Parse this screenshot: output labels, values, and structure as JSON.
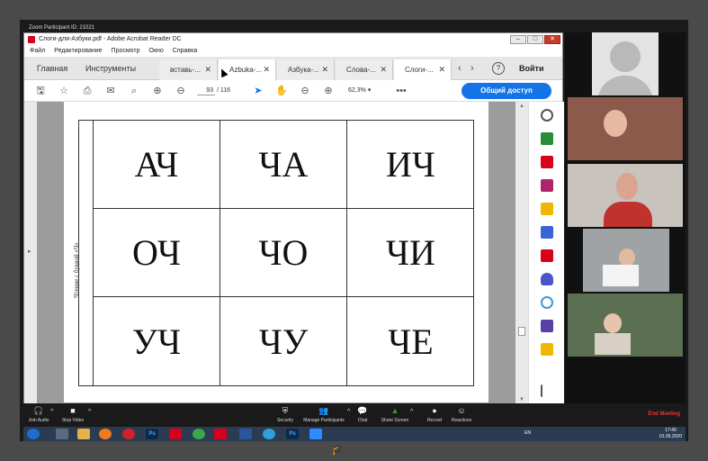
{
  "zoom_window": {
    "title": "Zoom Participant ID: 21021"
  },
  "acrobat": {
    "title": "Слоги-для-Азбуки.pdf - Adobe Acrobat Reader DC",
    "window_buttons": {
      "minimize": "–",
      "maximize": "□",
      "close": "✕"
    },
    "menu": [
      "Файл",
      "Редактирование",
      "Просмотр",
      "Окно",
      "Справка"
    ],
    "nav": {
      "home": "Главная",
      "tools": "Инструменты"
    },
    "tabs": [
      {
        "label": "вставь-...",
        "active": false
      },
      {
        "label": "Azbuka-...",
        "active": true
      },
      {
        "label": "Азбука-...",
        "active": false
      },
      {
        "label": "Слова-...",
        "active": false
      },
      {
        "label": "Слоги-...",
        "active": true
      }
    ],
    "tab_close": "✕",
    "tab_scroll": {
      "left": "‹",
      "right": "›"
    },
    "help": "?",
    "sign_in": "Войти",
    "toolbar": {
      "page_current": "93",
      "page_separator": "/",
      "page_total": "116",
      "zoom": "62,3%",
      "zoom_caret": "▾",
      "more": "•••",
      "share": "Общий доступ"
    },
    "document": {
      "side_caption": "Чтение с буквой «Ч»",
      "syllables": [
        [
          "АЧ",
          "ЧА",
          "ИЧ"
        ],
        [
          "ОЧ",
          "ЧО",
          "ЧИ"
        ],
        [
          "УЧ",
          "ЧУ",
          "ЧЕ"
        ]
      ]
    }
  },
  "zoom_controls": {
    "join_audio": "Join Audio",
    "stop_video": "Stop Video",
    "security": "Security",
    "manage_participants": "Manage Participants",
    "chat": "Chat",
    "share_screen": "Share Screen",
    "record": "Record",
    "reactions": "Reactions",
    "end_meeting": "End Meeting"
  },
  "taskbar": {
    "language": "EN",
    "time": "17:40",
    "date": "01.05.2020"
  },
  "colors": {
    "accent": "#1473e6",
    "acrobat_red": "#d9001b",
    "end_meeting": "#e23838",
    "share_green": "#2aa12a"
  }
}
